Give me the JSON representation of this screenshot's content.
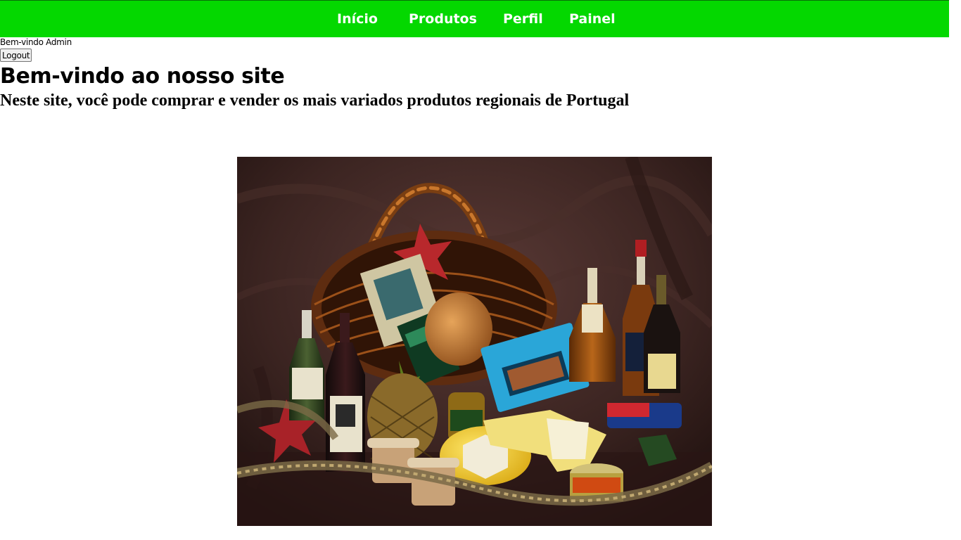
{
  "nav": {
    "items": [
      {
        "label": "Início"
      },
      {
        "label": "Produtos"
      },
      {
        "label": "Perfil"
      },
      {
        "label": "Painel"
      }
    ],
    "background_color": "#04d800",
    "text_color": "#ffffff"
  },
  "user": {
    "welcome_text": "Bem-vindo Admin",
    "logout_label": "Logout"
  },
  "main": {
    "title": "Bem-vindo ao nosso site",
    "subtitle": "Neste site, você pode comprar e vender os mais variados produtos regionais de Portugal"
  },
  "icons": {
    "scroll_up": "triangle-up-icon",
    "scroll_down": "triangle-down-icon"
  }
}
